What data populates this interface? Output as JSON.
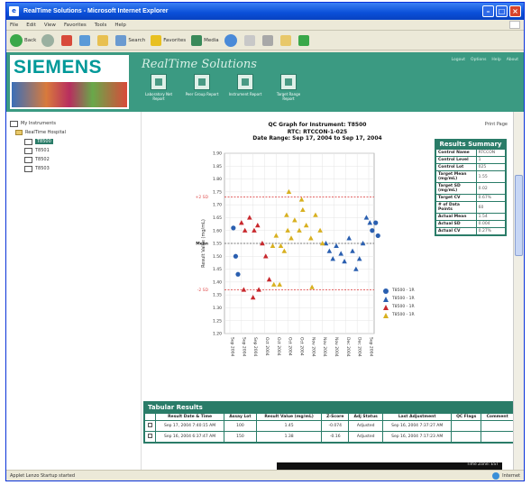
{
  "window": {
    "title": "RealTime Solutions - Microsoft Internet Explorer"
  },
  "menu": [
    "File",
    "Edit",
    "View",
    "Favorites",
    "Tools",
    "Help"
  ],
  "toolbar": {
    "back": "Back",
    "search": "Search",
    "favorites": "Favorites",
    "media": "Media"
  },
  "header": {
    "logo": "SIEMENS",
    "brand": "RealTime Solutions",
    "links": [
      "Logout",
      "Options",
      "Help",
      "About"
    ],
    "nav": [
      {
        "label": "Laboratory Net Report",
        "icon": "report-icon"
      },
      {
        "label": "Peer Group Report",
        "icon": "peer-group-icon"
      },
      {
        "label": "Instrument Report",
        "icon": "instrument-icon"
      },
      {
        "label": "Target Range Report",
        "icon": "target-range-icon"
      }
    ]
  },
  "tree": {
    "root": "My Instruments",
    "hospital": "RealTime Hospital",
    "items": [
      "T8500",
      "T8501",
      "T8502",
      "T8503"
    ]
  },
  "chart_title": {
    "line1": "QC Graph for Instrument: T8500",
    "line2": "RTC: RTCCON-1-025",
    "line3": "Date Range: Sep 17, 2004 to Sep 17, 2004"
  },
  "print_page": "Print Page",
  "summary": {
    "title": "Results Summary",
    "rows": [
      {
        "k": "Control Name",
        "v": "RTCCON"
      },
      {
        "k": "Control Level",
        "v": "1"
      },
      {
        "k": "Control Lot",
        "v": "025"
      },
      {
        "k": "Target Mean (mg/mL)",
        "v": "1.55"
      },
      {
        "k": "Target SD (mg/mL)",
        "v": "0.02"
      },
      {
        "k": "Target CV",
        "v": "0.67%"
      },
      {
        "k": "# of Data Points",
        "v": "60"
      },
      {
        "k": "Actual Mean",
        "v": "1.54"
      },
      {
        "k": "Actual SD",
        "v": "0.004"
      },
      {
        "k": "Actual CV",
        "v": "0.27%"
      }
    ]
  },
  "chart_data": {
    "type": "scatter",
    "ylabel": "Result Value (mg/mL)",
    "ylim": [
      1.2,
      1.9
    ],
    "yticks": [
      "1.90",
      "1.85",
      "1.80",
      "1.75",
      "1.70",
      "1.65",
      "1.60",
      "1.55",
      "1.50",
      "1.45",
      "1.40",
      "1.35",
      "1.30",
      "1.25",
      "1.20"
    ],
    "xticks": [
      "Sep 2004",
      "Sep 2004",
      "Sep 2004",
      "Oct 2004",
      "Oct 2004",
      "Oct 2004",
      "Oct 2004",
      "Nov 2004",
      "Nov 2004",
      "Nov 2004",
      "Dec 2004",
      "Dec 2004",
      "Sep 2004"
    ],
    "ref_lines": [
      {
        "label": "+2 SD",
        "value": 1.73,
        "color": "#e05050"
      },
      {
        "label": "Mean",
        "value": 1.55,
        "color": "#555555"
      },
      {
        "label": "-2 SD",
        "value": 1.37,
        "color": "#e05050"
      }
    ],
    "series": [
      {
        "name": "T8500 - 1R",
        "color": "#2a5fb0",
        "shape": "circle",
        "points": [
          [
            0.3,
            1.61
          ],
          [
            0.5,
            1.5
          ],
          [
            0.7,
            1.43
          ],
          [
            12.3,
            1.6
          ],
          [
            12.6,
            1.63
          ],
          [
            12.8,
            1.58
          ]
        ]
      },
      {
        "name": "T8500 - 1R",
        "color": "#2a5fb0",
        "shape": "triangle",
        "points": [
          [
            8.3,
            1.55
          ],
          [
            8.6,
            1.52
          ],
          [
            8.9,
            1.49
          ],
          [
            9.2,
            1.54
          ],
          [
            9.6,
            1.51
          ],
          [
            9.9,
            1.48
          ],
          [
            10.3,
            1.57
          ],
          [
            10.6,
            1.52
          ],
          [
            10.9,
            1.45
          ],
          [
            11.2,
            1.49
          ],
          [
            11.5,
            1.55
          ],
          [
            11.8,
            1.65
          ],
          [
            12.1,
            1.63
          ]
        ]
      },
      {
        "name": "T8500 - 1R",
        "color": "#c8282d",
        "shape": "triangle",
        "points": [
          [
            1.0,
            1.63
          ],
          [
            1.3,
            1.6
          ],
          [
            1.7,
            1.65
          ],
          [
            2.1,
            1.6
          ],
          [
            2.4,
            1.62
          ],
          [
            2.8,
            1.55
          ],
          [
            3.1,
            1.5
          ],
          [
            3.4,
            1.41
          ],
          [
            1.2,
            1.37
          ],
          [
            2.0,
            1.34
          ],
          [
            2.5,
            1.37
          ]
        ]
      },
      {
        "name": "T8500 - 1R",
        "color": "#d8b020",
        "shape": "triangle",
        "points": [
          [
            3.7,
            1.54
          ],
          [
            4.0,
            1.58
          ],
          [
            4.4,
            1.54
          ],
          [
            4.7,
            1.52
          ],
          [
            5.0,
            1.6
          ],
          [
            5.3,
            1.57
          ],
          [
            5.6,
            1.64
          ],
          [
            6.0,
            1.6
          ],
          [
            6.3,
            1.68
          ],
          [
            6.6,
            1.62
          ],
          [
            7.0,
            1.57
          ],
          [
            7.4,
            1.66
          ],
          [
            7.8,
            1.6
          ],
          [
            8.0,
            1.55
          ],
          [
            5.1,
            1.75
          ],
          [
            6.2,
            1.72
          ],
          [
            3.8,
            1.39
          ],
          [
            4.3,
            1.39
          ],
          [
            7.1,
            1.38
          ],
          [
            4.9,
            1.66
          ]
        ]
      }
    ]
  },
  "legend": [
    {
      "label": "T8500 - 1R",
      "color": "#2a5fb0",
      "shape": "circle"
    },
    {
      "label": "T8500 - 1R",
      "color": "#2a5fb0",
      "shape": "triangle"
    },
    {
      "label": "T8500 - 1R",
      "color": "#c8282d",
      "shape": "triangle"
    },
    {
      "label": "T8500 - 1R",
      "color": "#d8b020",
      "shape": "triangle"
    }
  ],
  "tabular": {
    "title": "Tabular Results",
    "headers": [
      "",
      "Result Date & Time",
      "Assay Lot",
      "Result Value (mg/mL)",
      "Z-Score",
      "Adj Status",
      "Last Adjustment",
      "QC Flags",
      "Comment"
    ],
    "rows": [
      [
        "",
        "Sep 17, 2004 7:40:15 AM",
        "100",
        "1.45",
        "-0.074",
        "Adjusted",
        "Sep 16, 2004 7:37:27 AM",
        "",
        ""
      ],
      [
        "",
        "Sep 16, 2004 6:37:47 AM",
        "150",
        "1.38",
        "-0.16",
        "Adjusted",
        "Sep 16, 2004 7:17:23 AM",
        "",
        ""
      ]
    ]
  },
  "footer": "Time Zone: EST",
  "status": {
    "left": "Applet Lenzo Startup started",
    "zone": "Internet"
  }
}
